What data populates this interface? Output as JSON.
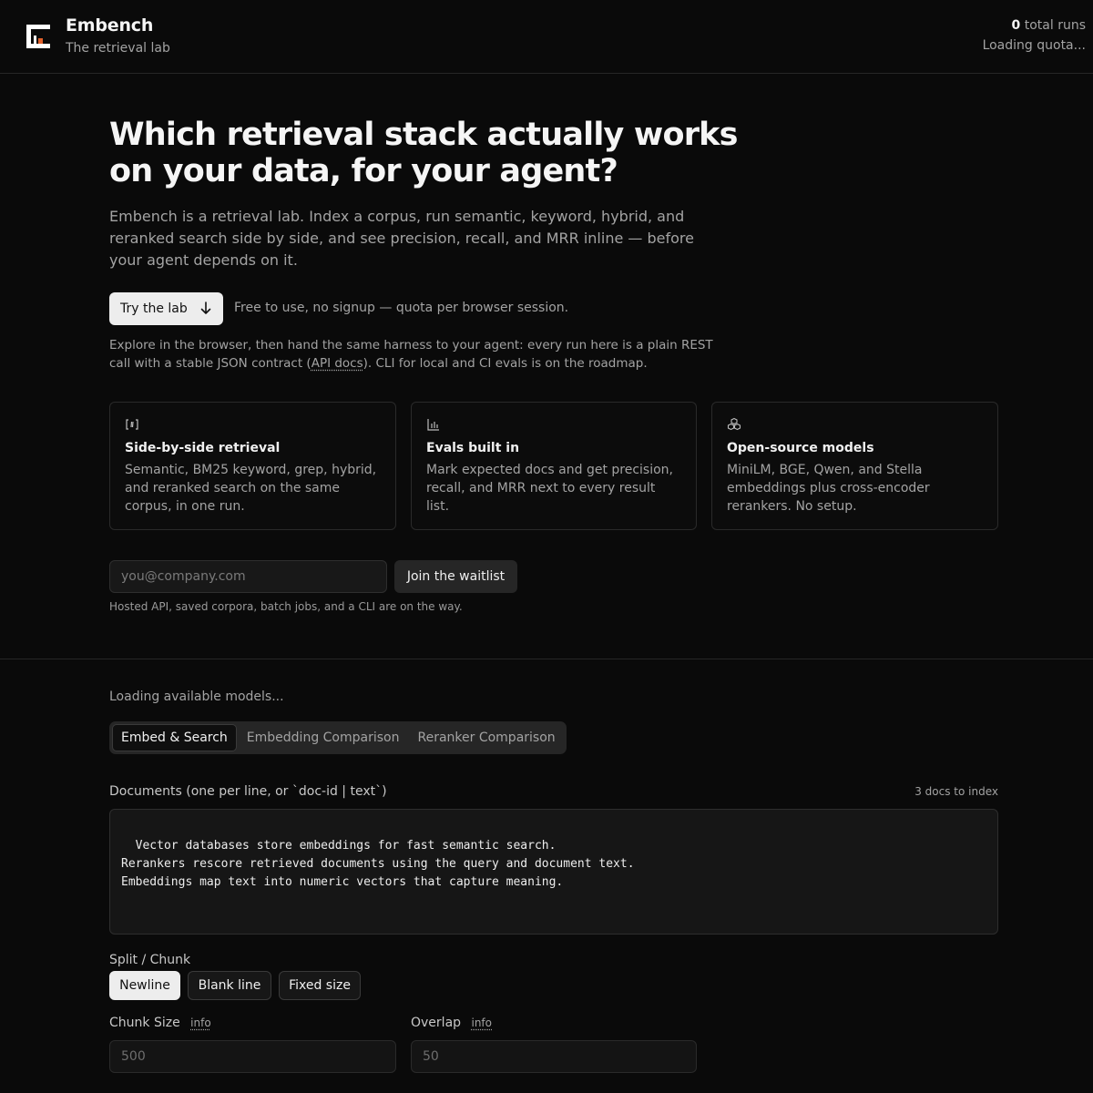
{
  "header": {
    "brand": "Embench",
    "tagline": "The retrieval lab",
    "runs_count": "0",
    "runs_label": "total runs",
    "quota": "Loading quota..."
  },
  "hero": {
    "title": "Which retrieval stack actually works on your data, for your agent?",
    "subtitle": "Embench is a retrieval lab. Index a corpus, run semantic, keyword, hybrid, and reranked search side by side, and see precision, recall, and MRR inline — before your agent depends on it.",
    "try_button": "Try the lab",
    "try_button_icon": "arrow-down-icon",
    "free_note": "Free to use, no signup — quota per browser session.",
    "explore_before": "Explore in the browser, then hand the same harness to your agent: every run here is a plain REST call with a stable JSON contract (",
    "explore_link": "API docs",
    "explore_after": "). CLI for local and CI evals is on the roadmap."
  },
  "features": [
    {
      "icon": "brackets-icon",
      "title": "Side-by-side retrieval",
      "description": "Semantic, BM25 keyword, grep, hybrid, and reranked search on the same corpus, in one run."
    },
    {
      "icon": "bar-chart-icon",
      "title": "Evals built in",
      "description": "Mark expected docs and get precision, recall, and MRR next to every result list."
    },
    {
      "icon": "cubes-icon",
      "title": "Open-source models",
      "description": "MiniLM, BGE, Qwen, and Stella embeddings plus cross-encoder rerankers. No setup."
    }
  ],
  "waitlist": {
    "email_placeholder": "you@company.com",
    "button": "Join the waitlist",
    "note": "Hosted API, saved corpora, batch jobs, and a CLI are on the way."
  },
  "lab": {
    "loading": "Loading available models...",
    "tabs": [
      "Embed & Search",
      "Embedding Comparison",
      "Reranker Comparison"
    ],
    "active_tab": "Embed & Search",
    "documents_label": "Documents (one per line, or `doc-id | text`)",
    "docs_count": "3 docs to index",
    "documents": "Vector databases store embeddings for fast semantic search.\nRerankers rescore retrieved documents using the query and document text.\nEmbeddings map text into numeric vectors that capture meaning.",
    "split_label": "Split / Chunk",
    "split_options": [
      "Newline",
      "Blank line",
      "Fixed size"
    ],
    "split_selected": "Newline",
    "chunk_size_label": "Chunk Size",
    "chunk_size_placeholder": "500",
    "overlap_label": "Overlap",
    "overlap_placeholder": "50",
    "info_label": "info"
  },
  "colors": {
    "background": "#0a0a0a",
    "primary_button": "#ededed",
    "muted_text": "#a3a3a3",
    "border": "#262626"
  }
}
